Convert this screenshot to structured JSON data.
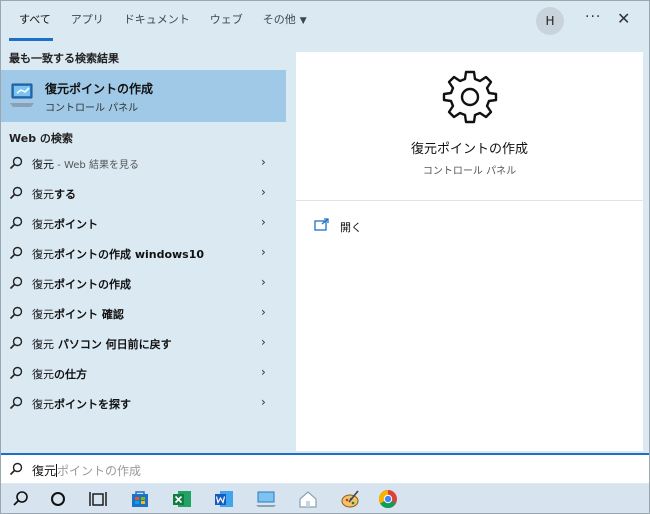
{
  "tabs": [
    {
      "label": "すべて",
      "active": true
    },
    {
      "label": "アプリ"
    },
    {
      "label": "ドキュメント"
    },
    {
      "label": "ウェブ"
    },
    {
      "label": "その他",
      "caret": "▼"
    }
  ],
  "header": {
    "avatar_initial": "H",
    "more_label": "···",
    "close_label": "✕"
  },
  "best_match": {
    "section_label": "最も一致する検索結果",
    "title": "復元ポイントの作成",
    "subtitle": "コントロール パネル",
    "icon": "control-panel-icon"
  },
  "web": {
    "section_label": "Web の検索",
    "items": [
      {
        "prefix": "復元",
        "bold": "",
        "hint": " - Web 結果を見る"
      },
      {
        "prefix": "復元",
        "bold": "する",
        "hint": ""
      },
      {
        "prefix": "復元",
        "bold": "ポイント",
        "hint": ""
      },
      {
        "prefix": "復元",
        "bold": "ポイントの作成 windows10",
        "hint": ""
      },
      {
        "prefix": "復元",
        "bold": "ポイントの作成",
        "hint": ""
      },
      {
        "prefix": "復元",
        "bold": "ポイント 確認",
        "hint": ""
      },
      {
        "prefix": "復元",
        "bold": " パソコン 何日前に戻す",
        "hint": ""
      },
      {
        "prefix": "復元",
        "bold": "の仕方",
        "hint": ""
      },
      {
        "prefix": "復元",
        "bold": "ポイントを探す",
        "hint": ""
      }
    ],
    "chevron": "›"
  },
  "detail": {
    "title": "復元ポイントの作成",
    "subtitle": "コントロール パネル",
    "action_label": "開く",
    "icon": "gear-icon"
  },
  "search": {
    "typed": "復元",
    "ghost": "ポイントの作成"
  },
  "taskbar": {
    "items": [
      "search-icon",
      "cortana-icon",
      "task-view-icon",
      "store-icon",
      "excel-icon",
      "word-icon",
      "pc-icon",
      "home-icon",
      "paint-icon",
      "chrome-icon"
    ]
  },
  "colors": {
    "accent": "#1e6fc7",
    "panel": "#dbe9f3",
    "selected": "#9fc9e6"
  }
}
